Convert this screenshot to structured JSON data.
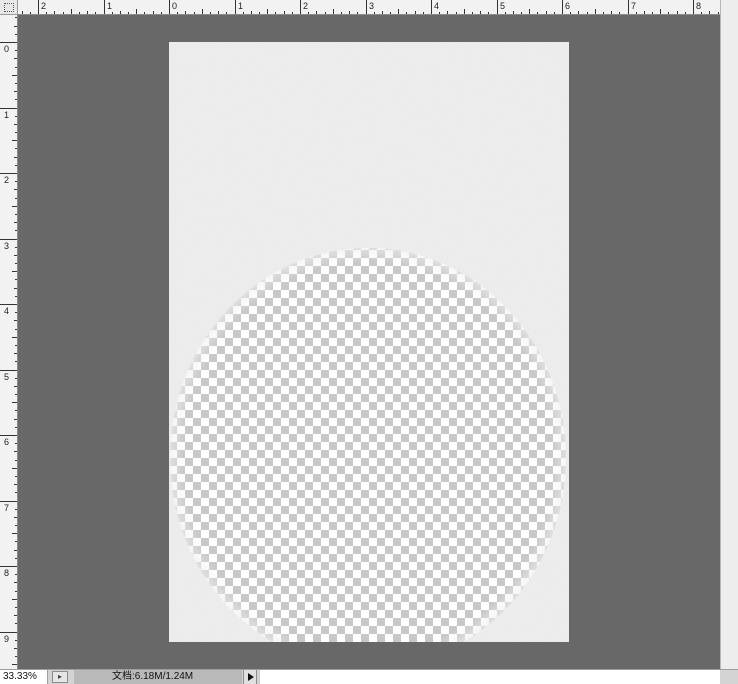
{
  "rulers": {
    "unit_label": "inches",
    "horizontal_labels": [
      "2",
      "1",
      "0",
      "1",
      "2",
      "3",
      "4",
      "5",
      "6",
      "7",
      "8"
    ],
    "vertical_labels": [
      "0",
      "1",
      "2",
      "3",
      "4",
      "5",
      "6",
      "7",
      "8",
      "9"
    ]
  },
  "document": {
    "texture": "light-gray-noise",
    "transparent_region": "circle",
    "transparency_pattern": "checkerboard"
  },
  "statusbar": {
    "zoom": "33.33%",
    "doc_info": "文档:6.18M/1.24M"
  },
  "colors": {
    "pasteboard": "#686868",
    "ruler_bg": "#f2f2f2",
    "paper": "#efefef",
    "checker_dark": "#c8c8c8",
    "checker_light": "#ffffff"
  }
}
